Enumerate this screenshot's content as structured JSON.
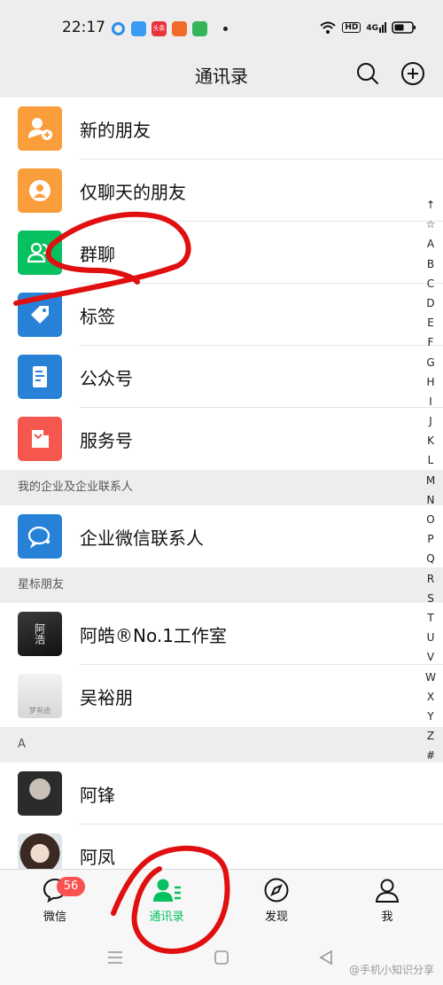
{
  "status_bar": {
    "time": "22:17",
    "badge_hd": "HD",
    "signal": "4G",
    "app_badge": "头条"
  },
  "header": {
    "title": "通讯录"
  },
  "top_items": [
    {
      "label": "新的朋友",
      "color": "#fa9d3b",
      "icon": "add-friend-icon"
    },
    {
      "label": "仅聊天的朋友",
      "color": "#fa9d3b",
      "icon": "chat-only-icon"
    },
    {
      "label": "群聊",
      "color": "#07c160",
      "icon": "group-chat-icon"
    },
    {
      "label": "标签",
      "color": "#2782d7",
      "icon": "tag-icon"
    },
    {
      "label": "公众号",
      "color": "#2782d7",
      "icon": "official-account-icon"
    },
    {
      "label": "服务号",
      "color": "#f5574e",
      "icon": "service-account-icon"
    }
  ],
  "sections": {
    "enterprise": "我的企业及企业联系人",
    "starred": "星标朋友",
    "a": "A"
  },
  "enterprise_item": {
    "label": "企业微信联系人",
    "color": "#2782d7"
  },
  "starred_items": [
    {
      "label": "阿皓®No.1工作室",
      "avatar_text": "阿浩"
    },
    {
      "label": "吴裕朋",
      "avatar_text": "梦有迹"
    }
  ],
  "a_items": [
    {
      "label": "阿锋"
    },
    {
      "label": "阿凤"
    }
  ],
  "index_letters": [
    "↑",
    "☆",
    "A",
    "B",
    "C",
    "D",
    "E",
    "F",
    "G",
    "H",
    "I",
    "J",
    "K",
    "L",
    "M",
    "N",
    "O",
    "P",
    "Q",
    "R",
    "S",
    "T",
    "U",
    "V",
    "W",
    "X",
    "Y",
    "Z",
    "#"
  ],
  "tabs": [
    {
      "label": "微信",
      "badge": "56"
    },
    {
      "label": "通讯录"
    },
    {
      "label": "发现"
    },
    {
      "label": "我"
    }
  ],
  "watermark": "@手机小知识分享",
  "colors": {
    "accent": "#07c160",
    "badge": "#fa5151",
    "annotation": "#e01010"
  }
}
